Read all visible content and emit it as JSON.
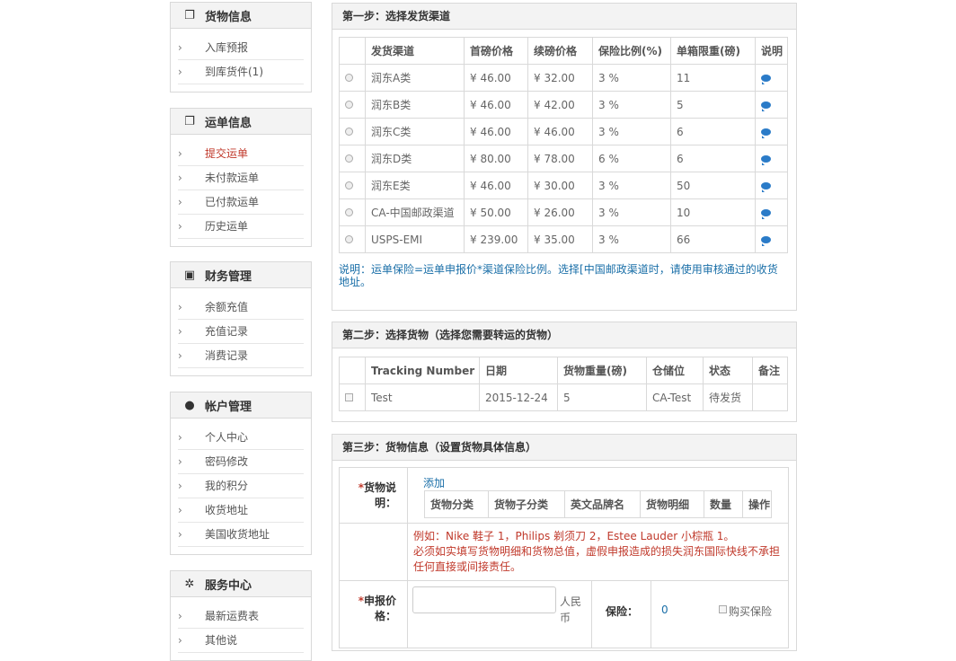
{
  "sidebar": {
    "panels": [
      {
        "title": "货物信息",
        "items": [
          "入库预报",
          "到库货件(1)"
        ]
      },
      {
        "title": "运单信息",
        "items": [
          "提交运单",
          "未付款运单",
          "已付款运单",
          "历史运单"
        ]
      },
      {
        "title": "财务管理",
        "items": [
          "余额充值",
          "充值记录",
          "消费记录"
        ]
      },
      {
        "title": "帐户管理",
        "items": [
          "个人中心",
          "密码修改",
          "我的积分",
          "收货地址",
          "美国收货地址"
        ]
      },
      {
        "title": "服务中心",
        "items": [
          "最新运费表",
          "其他说"
        ]
      }
    ],
    "chevron": "›"
  },
  "step1": {
    "title": "第一步：选择发货渠道",
    "headers": [
      "发货渠道",
      "首磅价格",
      "续磅价格",
      "保险比例(%)",
      "单箱限重(磅)",
      "说明"
    ],
    "rows": [
      [
        "润东A类",
        "¥ 46.00",
        "¥ 32.00",
        "3 %",
        "11"
      ],
      [
        "润东B类",
        "¥ 46.00",
        "¥ 42.00",
        "3 %",
        "5"
      ],
      [
        "润东C类",
        "¥ 46.00",
        "¥ 46.00",
        "3 %",
        "6"
      ],
      [
        "润东D类",
        "¥ 80.00",
        "¥ 78.00",
        "6 %",
        "6"
      ],
      [
        "润东E类",
        "¥ 46.00",
        "¥ 30.00",
        "3 %",
        "50"
      ],
      [
        "CA-中国邮政渠道",
        "¥ 50.00",
        "¥ 26.00",
        "3 %",
        "10"
      ],
      [
        "USPS-EMI",
        "¥ 239.00",
        "¥ 35.00",
        "3 %",
        "66"
      ]
    ],
    "note": "说明：运单保险=运单申报价*渠道保险比例。选择[中国邮政渠道时，请使用审核通过的收货地址。"
  },
  "step2": {
    "title": "第二步：选择货物（选择您需要转运的货物）",
    "headers": [
      "Tracking Number",
      "日期",
      "货物重量(磅)",
      "仓储位",
      "状态",
      "备注"
    ],
    "rows": [
      [
        "Test",
        "2015-12-24",
        "5",
        "CA-Test",
        "待发货",
        ""
      ]
    ]
  },
  "step3": {
    "title": "第三步：货物信息（设置货物具体信息）",
    "desc_label": "货物说明：",
    "add_link": "添加",
    "goods_headers": [
      "货物分类",
      "货物子分类",
      "英文品牌名",
      "货物明细",
      "数量",
      "操作"
    ],
    "example_line1": "例如：Nike 鞋子 1，Philips 剃须刀 2，Estee Lauder 小棕瓶 1。",
    "example_line2": "必须如实填写货物明细和货物总值，虚假申报造成的损失润东国际快线不承担任何直接或间接责任。",
    "declared_label": "申报价格：",
    "currency": "人民币",
    "insurance_label": "保险：",
    "insurance_value": "0",
    "buy_insurance": "购买保险"
  }
}
